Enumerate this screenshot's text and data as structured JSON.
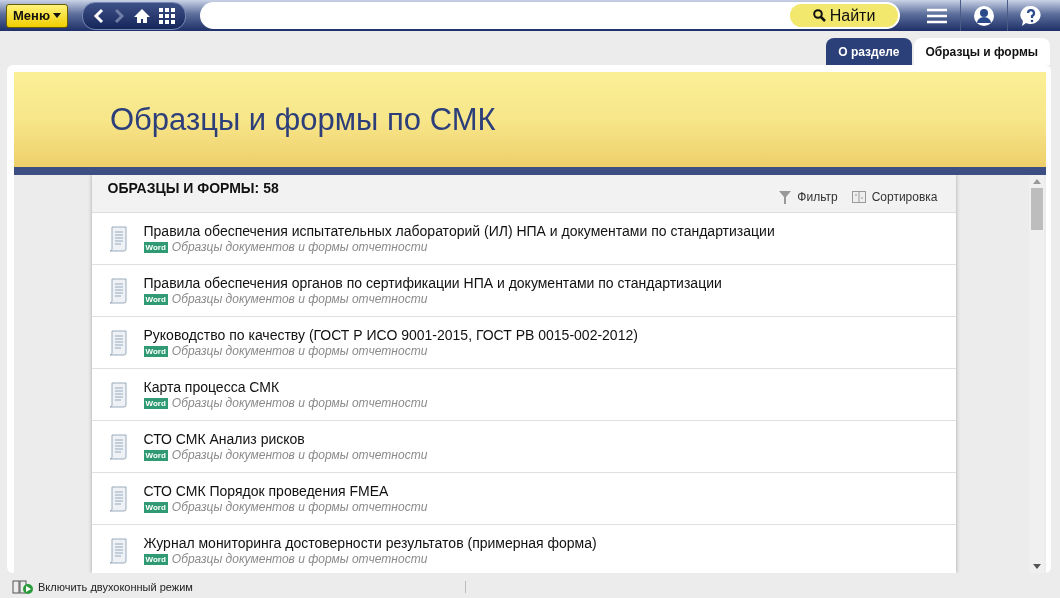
{
  "topbar": {
    "menu_button": "Меню",
    "search": {
      "button": "Найти"
    }
  },
  "tabs": [
    {
      "label": "О разделе",
      "selected": false
    },
    {
      "label": "Образцы и формы",
      "selected": true
    }
  ],
  "banner": {
    "title": "Образцы и формы по СМК"
  },
  "list": {
    "heading": "ОБРАЗЦЫ И ФОРМЫ: 58",
    "filter": "Фильтр",
    "sort": "Сортировка",
    "items": [
      {
        "title": "Правила обеспечения испытательных лабораторий (ИЛ) НПА и документами по стандартизации",
        "badge": "Word",
        "category": "Образцы документов и формы отчетности"
      },
      {
        "title": "Правила обеспечения органов по сертификации НПА и документами по стандартизации",
        "badge": "Word",
        "category": "Образцы документов и формы отчетности"
      },
      {
        "title": "Руководство по качеству (ГОСТ Р ИСО 9001-2015, ГОСТ РВ 0015-002-2012)",
        "badge": "Word",
        "category": "Образцы документов и формы отчетности"
      },
      {
        "title": "Карта процесса СМК",
        "badge": "Word",
        "category": "Образцы документов и формы отчетности"
      },
      {
        "title": "СТО СМК Анализ рисков",
        "badge": "Word",
        "category": "Образцы документов и формы отчетности"
      },
      {
        "title": "СТО СМК Порядок проведения FMEA",
        "badge": "Word",
        "category": "Образцы документов и формы отчетности"
      },
      {
        "title": "Журнал мониторинга достоверности результатов (примерная форма)",
        "badge": "Word",
        "category": "Образцы документов и формы отчетности"
      }
    ]
  },
  "status_bar": {
    "dual_window": "Включить двухоконный режим"
  }
}
